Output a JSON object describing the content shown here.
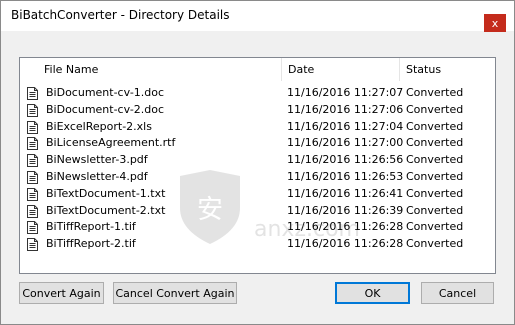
{
  "window": {
    "title": "BiBatchConverter - Directory Details",
    "close_glyph": "x"
  },
  "table": {
    "headers": {
      "file_name": "File Name",
      "date": "Date",
      "status": "Status"
    },
    "rows": [
      {
        "file_name": "BiDocument-cv-1.doc",
        "date": "11/16/2016 11:27:07",
        "status": "Converted"
      },
      {
        "file_name": "BiDocument-cv-2.doc",
        "date": "11/16/2016 11:27:06",
        "status": "Converted"
      },
      {
        "file_name": "BiExcelReport-2.xls",
        "date": "11/16/2016 11:27:04",
        "status": "Converted"
      },
      {
        "file_name": "BiLicenseAgreement.rtf",
        "date": "11/16/2016 11:27:00",
        "status": "Converted"
      },
      {
        "file_name": "BiNewsletter-3.pdf",
        "date": "11/16/2016 11:26:56",
        "status": "Converted"
      },
      {
        "file_name": "BiNewsletter-4.pdf",
        "date": "11/16/2016 11:26:53",
        "status": "Converted"
      },
      {
        "file_name": "BiTextDocument-1.txt",
        "date": "11/16/2016 11:26:41",
        "status": "Converted"
      },
      {
        "file_name": "BiTextDocument-2.txt",
        "date": "11/16/2016 11:26:39",
        "status": "Converted"
      },
      {
        "file_name": "BiTiffReport-1.tif",
        "date": "11/16/2016 11:26:28",
        "status": "Converted"
      },
      {
        "file_name": "BiTiffReport-2.tif",
        "date": "11/16/2016 11:26:28",
        "status": "Converted"
      }
    ],
    "row_icon": "document-icon"
  },
  "buttons": {
    "convert_again": "Convert Again",
    "cancel_convert_again": "Cancel Convert Again",
    "ok": "OK",
    "cancel": "Cancel"
  },
  "watermark": {
    "text": "anxz.com",
    "icon": "shield-watermark-icon"
  },
  "colors": {
    "close_button": "#c42b1c",
    "default_button_border": "#0078d7"
  }
}
